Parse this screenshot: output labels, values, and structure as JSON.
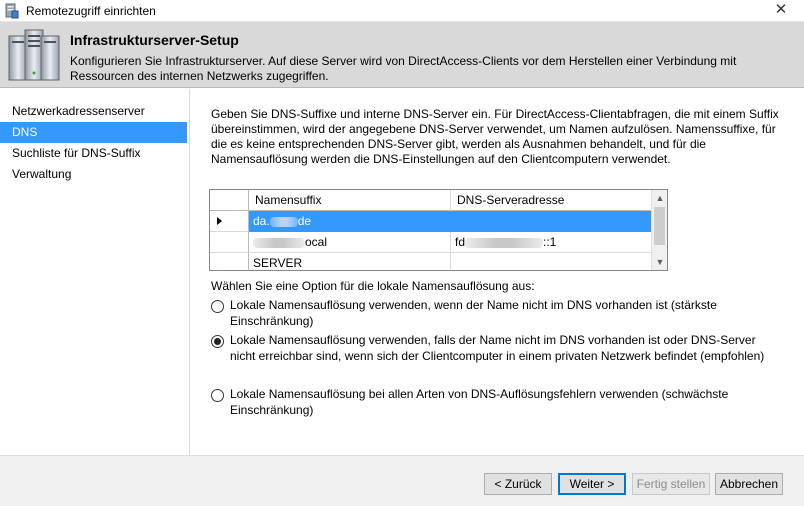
{
  "window": {
    "title": "Remotezugriff einrichten"
  },
  "header": {
    "title": "Infrastrukturserver-Setup",
    "description": "Konfigurieren Sie Infrastrukturserver. Auf diese Server wird von DirectAccess-Clients vor dem Herstellen einer Verbindung mit Ressourcen des internen Netzwerks zugegriffen."
  },
  "sidebar": {
    "items": [
      {
        "label": "Netzwerkadressenserver",
        "active": false
      },
      {
        "label": "DNS",
        "active": true
      },
      {
        "label": "Suchliste für DNS-Suffix",
        "active": false
      },
      {
        "label": "Verwaltung",
        "active": false
      }
    ]
  },
  "main": {
    "intro": "Geben Sie DNS-Suffixe und interne DNS-Server ein. Für DirectAccess-Clientabfragen, die mit einem Suffix übereinstimmen, wird der angegebene DNS-Server verwendet, um Namen aufzulösen. Namenssuffixe, für die es keine entsprechenden DNS-Server gibt, werden als Ausnahmen behandelt, und für die Namensauflösung werden die DNS-Einstellungen auf den Clientcomputern verwendet.",
    "table": {
      "columns": [
        "Namensuffix",
        "DNS-Serveradresse"
      ],
      "rows": [
        {
          "suffix_prefix": "da.",
          "suffix_suffix": "de",
          "server_prefix": "",
          "server_suffix": "",
          "selected": true
        },
        {
          "suffix_prefix": "",
          "suffix_suffix": "ocal",
          "server_prefix": "fd",
          "server_suffix": "::1",
          "selected": false
        },
        {
          "suffix_prefix": "SERVER",
          "suffix_suffix": "",
          "server_prefix": "",
          "server_suffix": "",
          "selected": false
        }
      ]
    },
    "option_label": "Wählen Sie eine Option für die lokale Namensauflösung aus:",
    "options": [
      {
        "label": "Lokale Namensauflösung verwenden, wenn der Name nicht im DNS vorhanden ist (stärkste Einschränkung)",
        "checked": false
      },
      {
        "label": "Lokale Namensauflösung verwenden, falls der Name nicht im DNS vorhanden ist oder DNS-Server nicht erreichbar sind, wenn sich der Clientcomputer in einem privaten Netzwerk befindet (empfohlen)",
        "checked": true
      },
      {
        "label": "Lokale Namensauflösung bei allen Arten von DNS-Auflösungsfehlern verwenden (schwächste Einschränkung)",
        "checked": false
      }
    ]
  },
  "footer": {
    "back": "< Zurück",
    "next": "Weiter >",
    "finish": "Fertig stellen",
    "cancel": "Abbrechen"
  },
  "colors": {
    "selection": "#3399ff",
    "header_bg": "#d9d9d9",
    "footer_bg": "#f0f0f0"
  },
  "icons": {
    "window": "wizard-app-icon",
    "header": "server-stack-icon",
    "close": "close-icon"
  }
}
